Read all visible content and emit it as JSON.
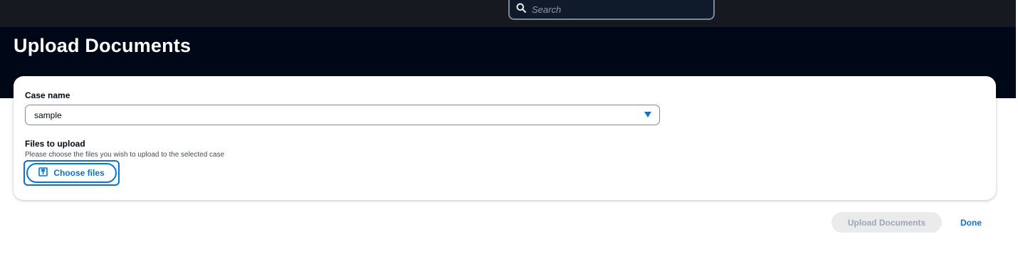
{
  "search": {
    "placeholder": "Search"
  },
  "page": {
    "title": "Upload Documents"
  },
  "form": {
    "case_name_label": "Case name",
    "case_name_value": "sample",
    "files_label": "Files to upload",
    "files_description": "Please choose the files you wish to upload to the selected case",
    "choose_files_label": "Choose files"
  },
  "actions": {
    "upload_label": "Upload Documents",
    "done_label": "Done"
  },
  "colors": {
    "topbar": "#16191f",
    "header": "#000716",
    "accent": "#0972d3",
    "disabled_bg": "#e9ebed",
    "disabled_text": "#9ba7b6"
  }
}
